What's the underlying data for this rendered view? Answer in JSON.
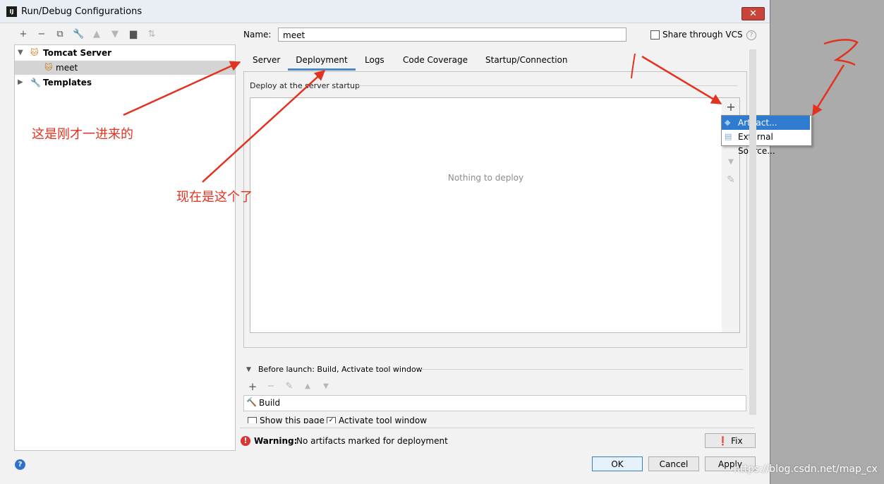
{
  "window": {
    "title": "Run/Debug Configurations",
    "app_icon": "IJ"
  },
  "toolbar": {
    "icons": [
      "add-icon",
      "remove-icon",
      "copy-icon",
      "wrench-icon",
      "move-up-icon",
      "move-down-icon",
      "folder-icon",
      "sort-icon"
    ]
  },
  "tree": {
    "items": [
      {
        "label": "Tomcat Server",
        "bold": true,
        "expanded": true
      },
      {
        "label": "meet",
        "selected": true
      },
      {
        "label": "Templates",
        "bold": true,
        "expanded": false
      }
    ]
  },
  "form": {
    "name_label": "Name:",
    "name_value": "meet",
    "share_label": "Share through VCS",
    "share_checked": false
  },
  "tabs": [
    "Server",
    "Deployment",
    "Logs",
    "Code Coverage",
    "Startup/Connection"
  ],
  "active_tab": "Deployment",
  "deploy": {
    "section_title": "Deploy at the server startup",
    "empty_text": "Nothing to deploy",
    "menu": [
      "Artifact...",
      "External Source..."
    ]
  },
  "before_launch": {
    "title": "Before launch: Build, Activate tool window",
    "items": [
      "Build"
    ],
    "show_page_label": "Show this page",
    "activate_label": "Activate tool window"
  },
  "warning": {
    "bold": "Warning:",
    "text": "No artifacts marked for deployment"
  },
  "buttons": {
    "fix": "Fix",
    "ok": "OK",
    "cancel": "Cancel",
    "apply": "Apply"
  },
  "annotations": {
    "note1": "这是刚才一进来的",
    "note2": "现在是这个了",
    "mark1": "1",
    "mark2": "2",
    "color": "#e3321f"
  },
  "watermark": "https://blog.csdn.net/map_cx"
}
